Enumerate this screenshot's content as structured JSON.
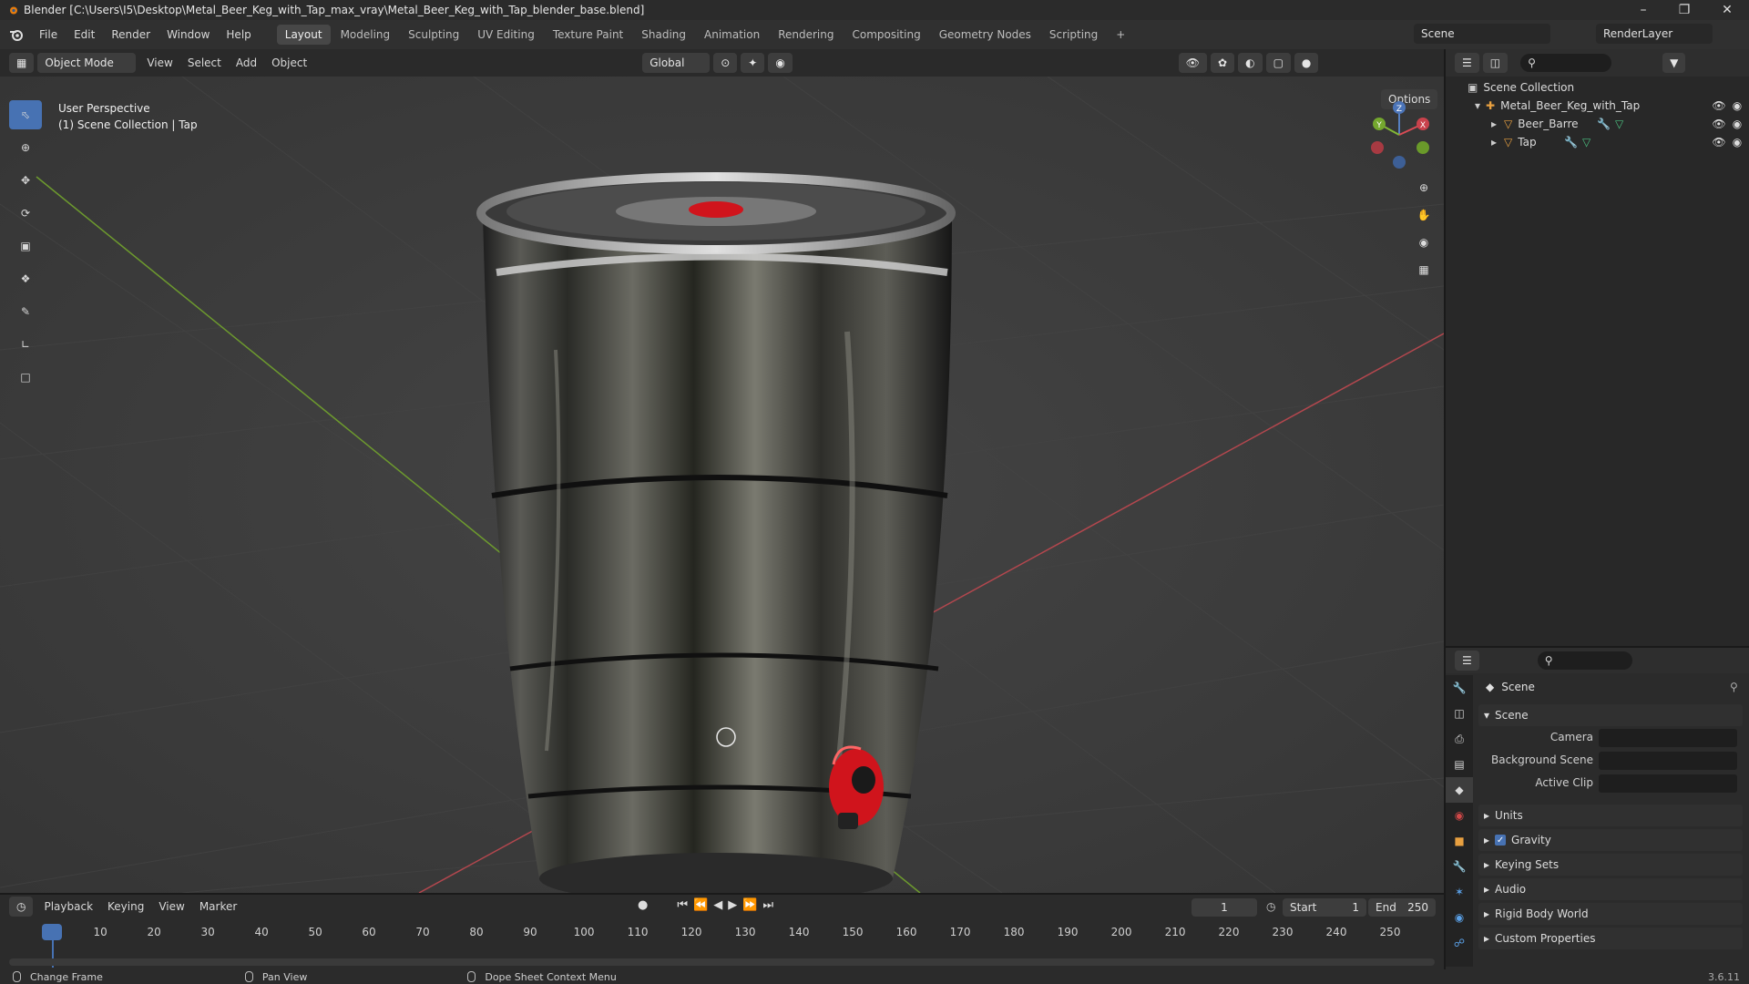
{
  "window": {
    "title": "Blender [C:\\Users\\I5\\Desktop\\Metal_Beer_Keg_with_Tap_max_vray\\Metal_Beer_Keg_with_Tap_blender_base.blend]"
  },
  "menu": [
    "File",
    "Edit",
    "Render",
    "Window",
    "Help"
  ],
  "workspaces": [
    "Layout",
    "Modeling",
    "Sculpting",
    "UV Editing",
    "Texture Paint",
    "Shading",
    "Animation",
    "Rendering",
    "Compositing",
    "Geometry Nodes",
    "Scripting"
  ],
  "active_workspace": "Layout",
  "scene_name": "Scene",
  "render_layer": "RenderLayer",
  "viewport": {
    "mode": "Object Mode",
    "menus": [
      "View",
      "Select",
      "Add",
      "Object"
    ],
    "orientation": "Global",
    "options_label": "Options",
    "info_line1": "User Perspective",
    "info_line2": "(1) Scene Collection | Tap",
    "gizmo_axes": {
      "z": "Z",
      "y": "Y",
      "x": "X"
    }
  },
  "outliner": {
    "root": "Scene Collection",
    "collection": "Metal_Beer_Keg_with_Tap",
    "objects": [
      "Beer_Barre",
      "Tap"
    ]
  },
  "properties": {
    "context_label": "Scene",
    "panel_scene": "Scene",
    "camera_label": "Camera",
    "background_scene_label": "Background Scene",
    "active_clip_label": "Active Clip",
    "sections": [
      "Units",
      "Gravity",
      "Keying Sets",
      "Audio",
      "Rigid Body World",
      "Custom Properties"
    ],
    "gravity_checked": true
  },
  "timeline": {
    "menus": [
      "Playback",
      "Keying",
      "View",
      "Marker"
    ],
    "current_frame": "1",
    "start_label": "Start",
    "start_value": "1",
    "end_label": "End",
    "end_value": "250",
    "ticks": [
      "1",
      "10",
      "20",
      "30",
      "40",
      "50",
      "60",
      "70",
      "80",
      "90",
      "100",
      "110",
      "120",
      "130",
      "140",
      "150",
      "160",
      "170",
      "180",
      "190",
      "200",
      "210",
      "220",
      "230",
      "240",
      "250"
    ]
  },
  "statusbar": {
    "items": [
      "Change Frame",
      "Pan View",
      "Dope Sheet Context Menu"
    ],
    "version": "3.6.11"
  },
  "colors": {
    "accent": "#4772b3",
    "x_axis": "#b3474e",
    "y_axis": "#6d9a2e",
    "keg_red": "#d0141c"
  }
}
